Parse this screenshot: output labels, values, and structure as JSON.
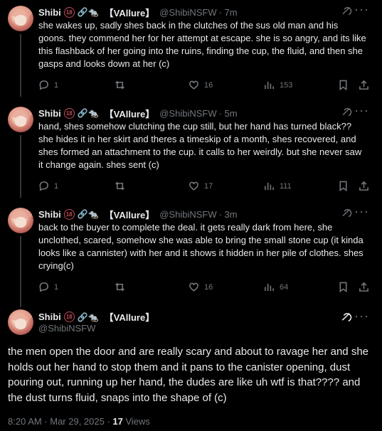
{
  "thread": {
    "tweets": [
      {
        "name": "Shibi",
        "emoji": "🔞🔗🐀",
        "bracket": "【VAllure】",
        "handle": "@ShibiNSFW",
        "time": "· 7m",
        "text": "she wakes up, sadly shes back in the clutches of the sus old man and his goons. they commend her for her attempt at escape. she is so angry, and its like this flashback of her going into the ruins, finding the cup, the fluid, and then she gasps and looks down at her (c)",
        "replies": "1",
        "reposts": "",
        "likes": "16",
        "views": "153"
      },
      {
        "name": "Shibi",
        "emoji": "🔞🔗🐀",
        "bracket": "【VAllure】",
        "handle": "@ShibiNSFW",
        "time": "· 5m",
        "text": "hand, shes somehow clutching the cup still, but her hand has turned black?? she hides it in her skirt and theres a timeskip of a month, shes recovered, and shes formed an attachment to the cup. it calls to her weirdly. but she never saw it change again. shes sent (c)",
        "replies": "1",
        "reposts": "",
        "likes": "17",
        "views": "111"
      },
      {
        "name": "Shibi",
        "emoji": "🔞🔗🐀",
        "bracket": "【VAllure】",
        "handle": "@ShibiNSFW",
        "time": "· 3m",
        "text": "back to the buyer to complete the deal. it gets really dark from here, she unclothed, scared, somehow she was able to bring the small stone cup (it kinda looks like a cannister) with her and it shows it hidden in her pile of clothes. shes crying(c)",
        "replies": "1",
        "reposts": "",
        "likes": "16",
        "views": "64"
      }
    ],
    "main": {
      "name": "Shibi",
      "emoji": "🔞🔗🐀",
      "bracket": "【VAllure】",
      "handle": "@ShibiNSFW",
      "text": "the men open the door and are really scary and about to ravage her and she holds out her hand to stop them and it pans to the canister opening, dust pouring out, running up her hand, the dudes are like uh wtf is that???? and the dust turns fluid, snaps into the shape of (c)",
      "timestamp": "8:20 AM · Mar 29, 2025 · ",
      "views_count": "17",
      "views_label": " Views"
    }
  },
  "colors": {
    "background": "#000000",
    "text": "#e7e9ea",
    "secondary": "#71767b",
    "divider": "#333639",
    "badge": "#c54b58"
  },
  "icons": [
    "reply-icon",
    "repost-icon",
    "like-icon",
    "views-icon",
    "bookmark-icon",
    "share-icon",
    "grok-icon",
    "more-icon"
  ]
}
